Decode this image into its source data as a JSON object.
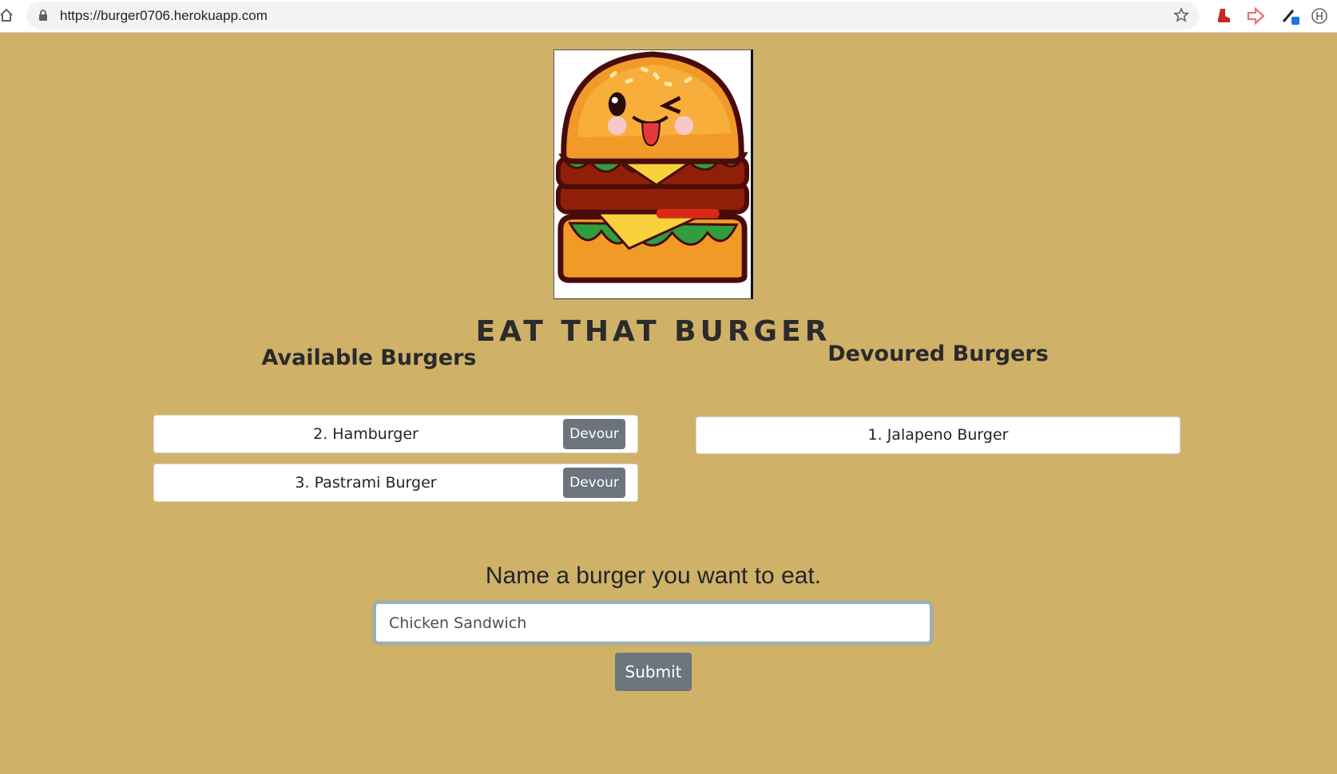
{
  "browser": {
    "url": "https://burger0706.herokuapp.com",
    "icons": [
      "home-icon",
      "lock-icon",
      "star-icon",
      "boot-extension-icon",
      "forward-extension-icon",
      "eyedropper-extension-icon",
      "h-extension-icon"
    ]
  },
  "page": {
    "title": "EAT THAT BURGER",
    "available_heading": "Available Burgers",
    "devoured_heading": "Devoured Burgers",
    "available_burgers": [
      {
        "label": "2. Hamburger",
        "button": "Devour"
      },
      {
        "label": "3. Pastrami Burger",
        "button": "Devour"
      }
    ],
    "devoured_burgers": [
      {
        "label": "1. Jalapeno Burger"
      }
    ],
    "form": {
      "prompt": "Name a burger you want to eat.",
      "input_value": "Chicken Sandwich",
      "submit_label": "Submit"
    }
  },
  "colors": {
    "background": "#cfb168",
    "button": "#6c757d"
  }
}
